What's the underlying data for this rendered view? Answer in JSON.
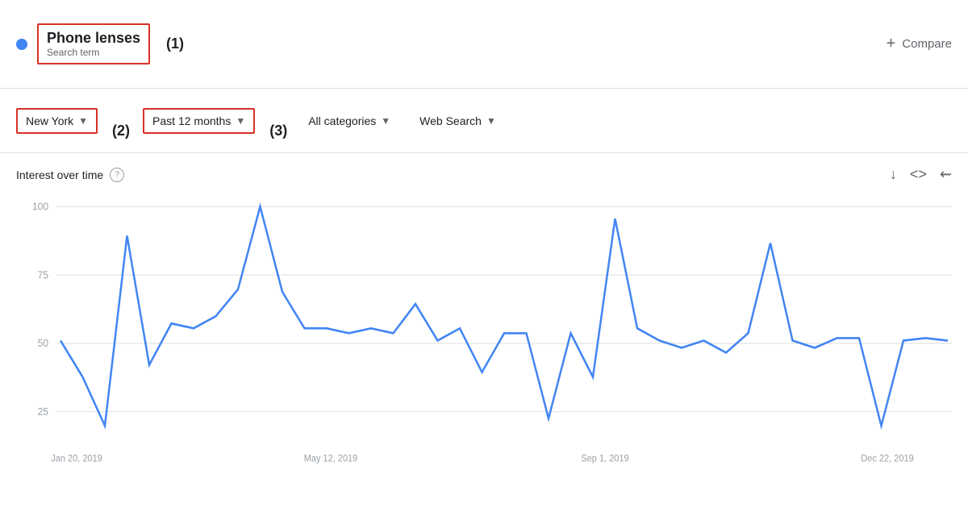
{
  "header": {
    "dot_color": "#4285f4",
    "search_term": "Phone lenses",
    "search_term_sub": "Search term",
    "term_number": "(1)",
    "compare_label": "Compare",
    "compare_plus": "+"
  },
  "filters": {
    "location": {
      "label": "New York",
      "number": "(2)"
    },
    "time_range": {
      "label": "Past 12 months",
      "number": "(3)"
    },
    "category": {
      "label": "All categories"
    },
    "search_type": {
      "label": "Web Search"
    }
  },
  "chart": {
    "title": "Interest over time",
    "help_icon": "?",
    "x_labels": [
      "Jan 20, 2019",
      "May 12, 2019",
      "Sep 1, 2019",
      "Dec 22, 2019"
    ],
    "y_labels": [
      "100",
      "75",
      "50",
      "25"
    ],
    "data_points": [
      45,
      30,
      10,
      88,
      35,
      52,
      50,
      55,
      66,
      100,
      65,
      50,
      50,
      48,
      50,
      48,
      60,
      45,
      50,
      32,
      48,
      48,
      13,
      48,
      30,
      95,
      50,
      45,
      42,
      45,
      40,
      48,
      85,
      45,
      42,
      46,
      46,
      10,
      45,
      46,
      45
    ]
  }
}
